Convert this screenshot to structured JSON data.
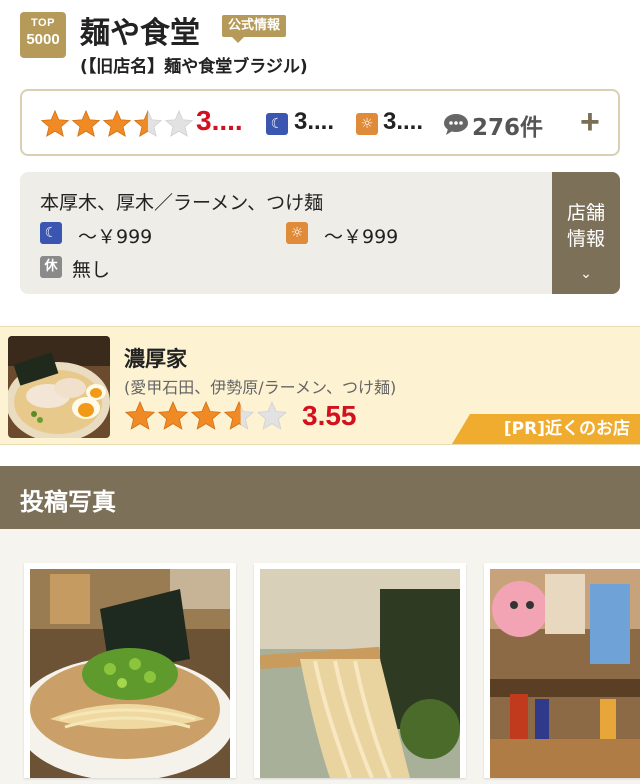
{
  "header": {
    "rank_badge_line1": "TOP",
    "rank_badge_line2": "5000",
    "shop_name": "麺や食堂",
    "official_label": "公式情報",
    "former_name": "(【旧店名】麺や食堂ブラジル)"
  },
  "rating": {
    "stars": 3.5,
    "score": "3....",
    "dinner_score": "3....",
    "lunch_score": "3....",
    "review_count": "276件",
    "expand_symbol": "+"
  },
  "info": {
    "area_genre": "本厚木、厚木／ラーメン、つけ麺",
    "dinner_price": "～￥999",
    "lunch_price": "～￥999",
    "closed_icon_label": "休",
    "closed_days": "無し",
    "shop_info_button": "店舗情報",
    "chevron": "⌄"
  },
  "pr": {
    "shop_name": "濃厚家",
    "subtitle": "(愛甲石田、伊勢原/ラーメン、つけ麺)",
    "stars": 3.55,
    "score": "3.55",
    "tag": "[PR]近くのお店"
  },
  "photos": {
    "section_title": "投稿写真",
    "items": [
      "ramen-bowl-photo",
      "noodles-lift-photo",
      "shop-interior-photo"
    ]
  },
  "colors": {
    "gold": "#b59a5a",
    "brown": "#7d7058",
    "star": "#f08a24",
    "score_red": "#d3101d",
    "pr_bg": "#fdf3d2",
    "pr_tag": "#f0ac2e"
  }
}
